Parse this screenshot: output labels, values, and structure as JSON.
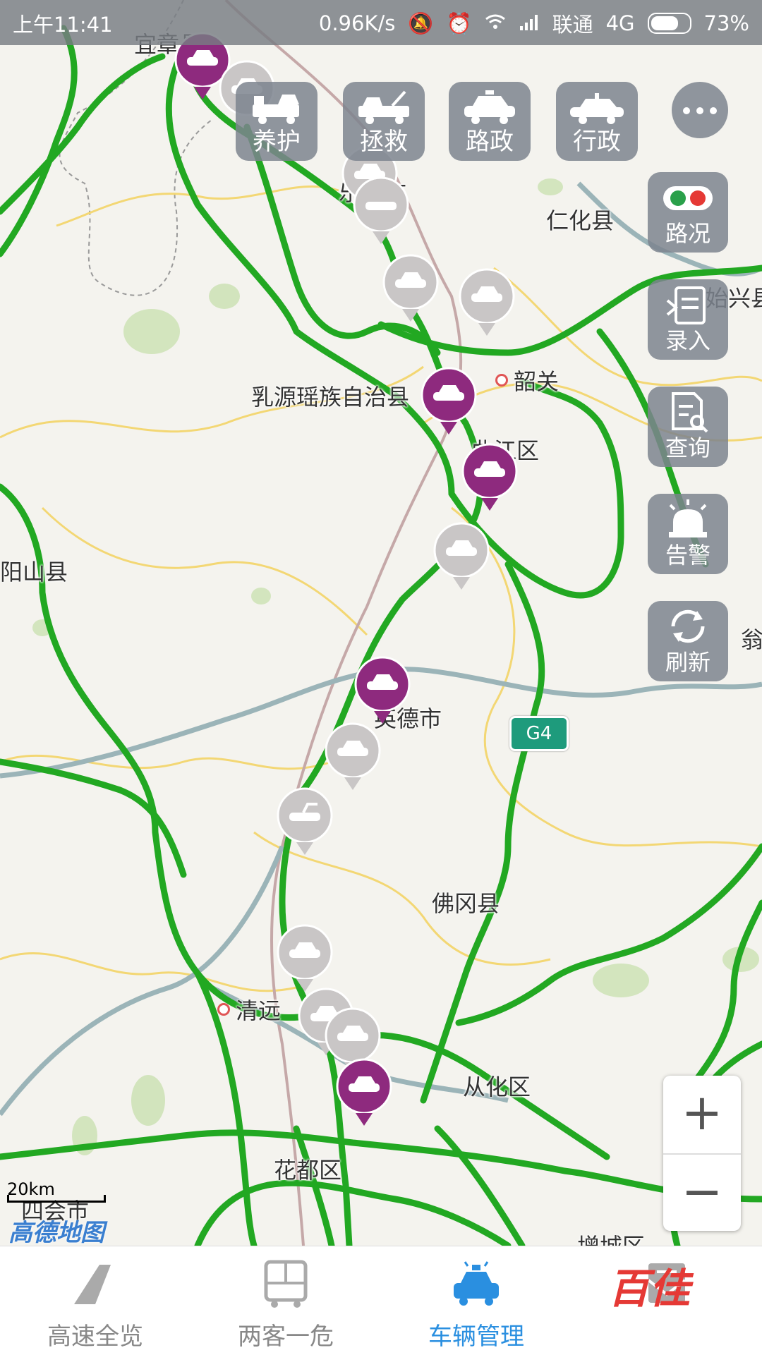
{
  "status_bar": {
    "time": "上午11:41",
    "speed": "0.96K/s",
    "carrier": "联通",
    "network": "4G",
    "battery": "73%"
  },
  "top_buttons": [
    {
      "label": "养护",
      "icon": "maintenance-truck-icon"
    },
    {
      "label": "拯救",
      "icon": "tow-truck-icon"
    },
    {
      "label": "路政",
      "icon": "road-admin-car-icon"
    },
    {
      "label": "行政",
      "icon": "admin-car-icon"
    }
  ],
  "side_buttons": [
    {
      "label": "路况",
      "icon": "traffic-light-icon"
    },
    {
      "label": "录入",
      "icon": "entry-icon"
    },
    {
      "label": "查询",
      "icon": "query-icon"
    },
    {
      "label": "告警",
      "icon": "alarm-icon"
    },
    {
      "label": "刷新",
      "icon": "refresh-icon"
    }
  ],
  "map": {
    "places": {
      "yizhang": "宜章县",
      "lechang": "乐昌市",
      "renhua": "仁化县",
      "shixing": "始兴县",
      "shaoguan": "韶关",
      "ruyuan": "乳源瑶族自治县",
      "qujiang": "曲江区",
      "shanxian": "阳山县",
      "weng": "翁",
      "yingde": "英德市",
      "fogang": "佛冈县",
      "qingyuan": "清远",
      "conghua": "从化区",
      "huadu": "花都区",
      "sihui": "四会市",
      "zengcheng": "增城区"
    },
    "highway_badge": "G4",
    "scale": "20km",
    "provider": "高德地图"
  },
  "zoom": {
    "in": "+",
    "out": "−"
  },
  "bottom_nav": [
    {
      "label": "高速全览",
      "icon": "highway-icon",
      "active": false
    },
    {
      "label": "两客一危",
      "icon": "bus-icon",
      "active": false
    },
    {
      "label": "车辆管理",
      "icon": "police-car-icon",
      "active": true
    },
    {
      "label": "",
      "icon": "mail-icon",
      "active": false
    }
  ],
  "brand": "百佳",
  "colors": {
    "road_green": "#22a822",
    "marker_purple": "#8e2a7e",
    "marker_grey": "#c9c6c6",
    "accent_blue": "#2a8fe0",
    "brand_red": "#e53935"
  }
}
